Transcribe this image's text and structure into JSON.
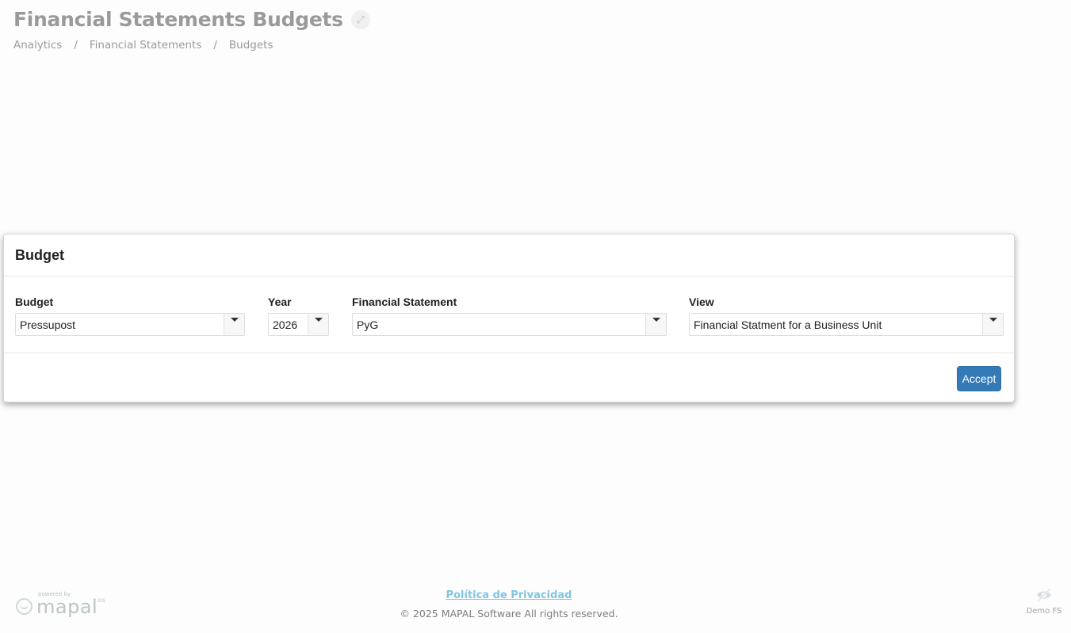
{
  "header": {
    "title": "Financial Statements Budgets",
    "expand_icon": "expand-icon",
    "breadcrumb": [
      "Analytics",
      "Financial Statements",
      "Budgets"
    ],
    "breadcrumb_separator": "/"
  },
  "modal": {
    "title": "Budget",
    "fields": {
      "budget": {
        "label": "Budget",
        "value": "Pressupost"
      },
      "year": {
        "label": "Year",
        "value": "2026"
      },
      "financial_statement": {
        "label": "Financial Statement",
        "value": "PyG"
      },
      "view": {
        "label": "View",
        "value": "Financial Statment for a Business Unit"
      }
    },
    "accept_label": "Accept",
    "accent_color": "#337ab7"
  },
  "footer": {
    "logo_powered_by": "powered by",
    "logo_word": "mapal",
    "logo_suffix": "os",
    "privacy_link": "Política de Privacidad",
    "copyright": "© 2025 MAPAL Software All rights reserved.",
    "demo_label": "Demo FS",
    "demo_icon": "hidden-eye-icon"
  }
}
